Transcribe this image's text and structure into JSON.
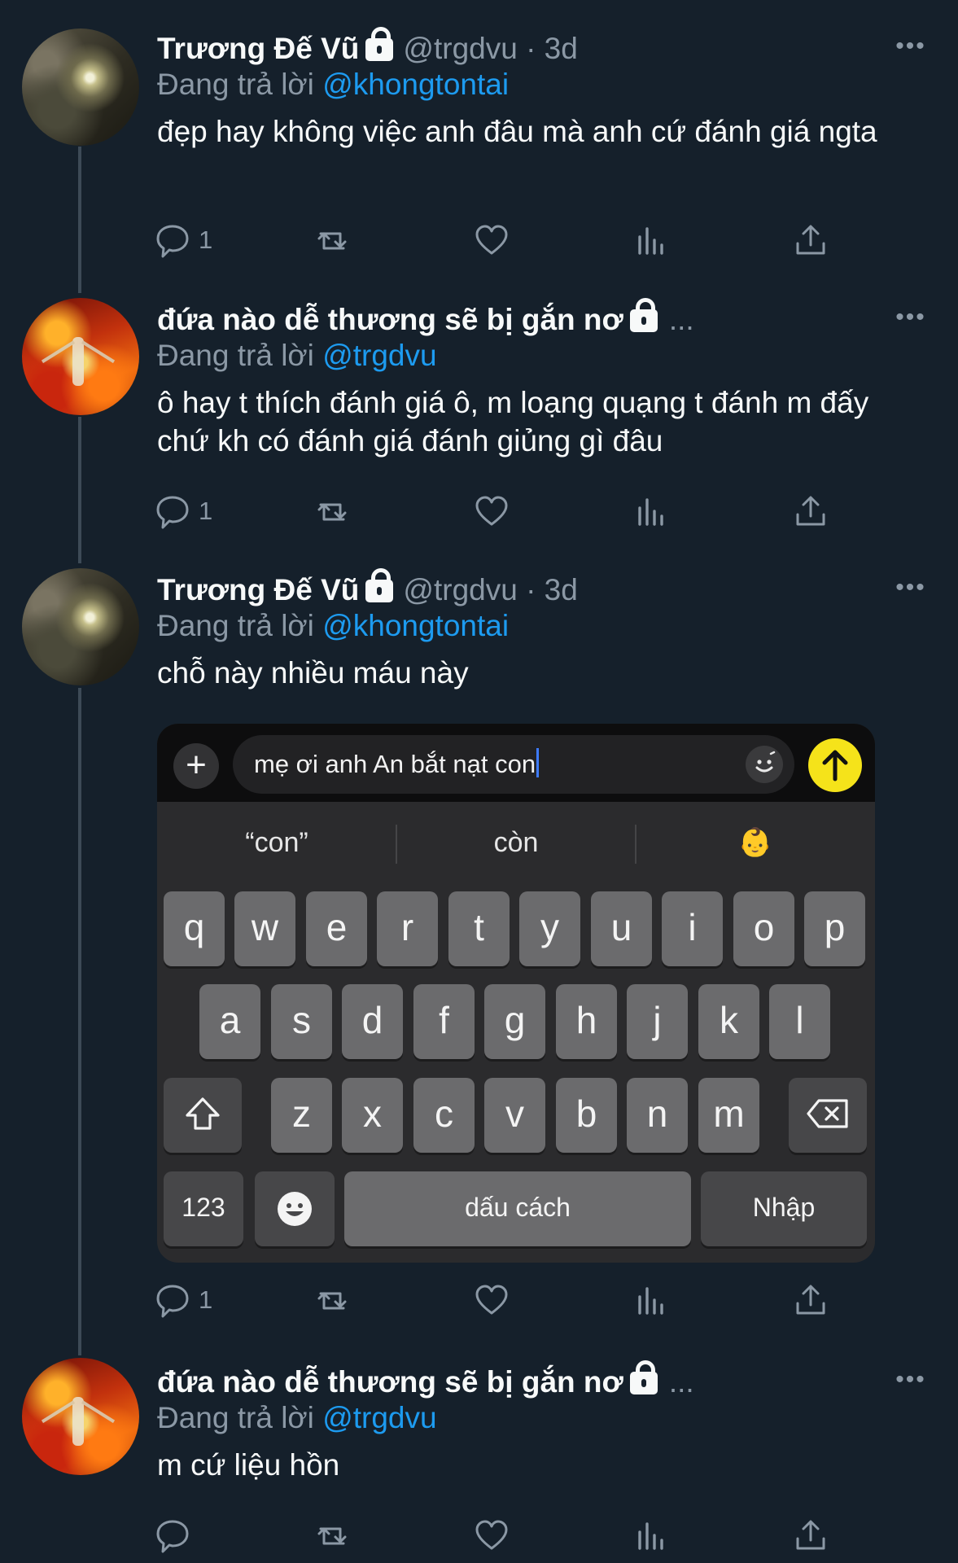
{
  "tweets": [
    {
      "name": "Trương Đế Vũ",
      "handle": "@trgdvu · 3d",
      "reply_prefix": "Đang trả lời",
      "reply_mention": "@khongtontai",
      "text": "đẹp hay không việc anh đâu mà anh cứ đánh giá ngta",
      "reply_count": "1",
      "avatar": "photo"
    },
    {
      "name": "đứa nào dễ thương sẽ bị gắn nơ",
      "handle": "...",
      "reply_prefix": "Đang trả lời",
      "reply_mention": "@trgdvu",
      "text": "ô hay t thích đánh giá ô, m loạng quạng t đánh m đấy chứ kh có đánh giá đánh giủng gì đâu",
      "reply_count": "1",
      "avatar": "fire"
    },
    {
      "name": "Trương Đế Vũ",
      "handle": "@trgdvu · 3d",
      "reply_prefix": "Đang trả lời",
      "reply_mention": "@khongtontai",
      "text": "chỗ này nhiều máu này",
      "reply_count": "1",
      "avatar": "photo"
    },
    {
      "name": "đứa nào dễ thương sẽ bị gắn nơ",
      "handle": "...",
      "reply_prefix": "Đang trả lời",
      "reply_mention": "@trgdvu",
      "text": "m cứ liệu hồn",
      "reply_count": "",
      "avatar": "fire"
    }
  ],
  "keyboard": {
    "input_text": "mẹ ơi anh An bắt nạt con",
    "plus_label": "+",
    "suggestions": [
      "“con”",
      "còn",
      "👶"
    ],
    "row1": [
      "q",
      "w",
      "e",
      "r",
      "t",
      "y",
      "u",
      "i",
      "o",
      "p"
    ],
    "row2": [
      "a",
      "s",
      "d",
      "f",
      "g",
      "h",
      "j",
      "k",
      "l"
    ],
    "row3": [
      "z",
      "x",
      "c",
      "v",
      "b",
      "n",
      "m"
    ],
    "numbers_label": "123",
    "emoji_key": "😀",
    "space_label": "dấu cách",
    "return_label": "Nhập"
  },
  "colors": {
    "background": "#15202b",
    "mention": "#1d9bf0",
    "muted": "#8b98a5",
    "send_button": "#f5e31a"
  }
}
